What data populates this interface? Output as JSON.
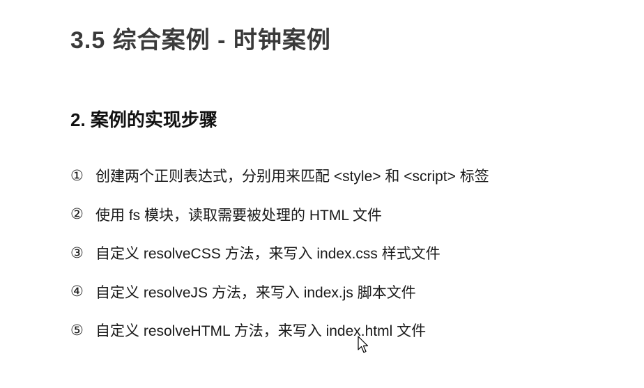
{
  "slide": {
    "title": "3.5 综合案例 - 时钟案例",
    "subtitle": "2. 案例的实现步骤",
    "steps": [
      {
        "num": "①",
        "text": "创建两个正则表达式，分别用来匹配 <style> 和 <script> 标签"
      },
      {
        "num": "②",
        "text": "使用 fs 模块，读取需要被处理的 HTML 文件"
      },
      {
        "num": "③",
        "text": "自定义 resolveCSS 方法，来写入 index.css 样式文件"
      },
      {
        "num": "④",
        "text": "自定义 resolveJS 方法，来写入 index.js 脚本文件"
      },
      {
        "num": "⑤",
        "text": "自定义 resolveHTML 方法，来写入 index.html 文件"
      }
    ]
  },
  "cursor": {
    "icon": "mouse-pointer-icon"
  }
}
